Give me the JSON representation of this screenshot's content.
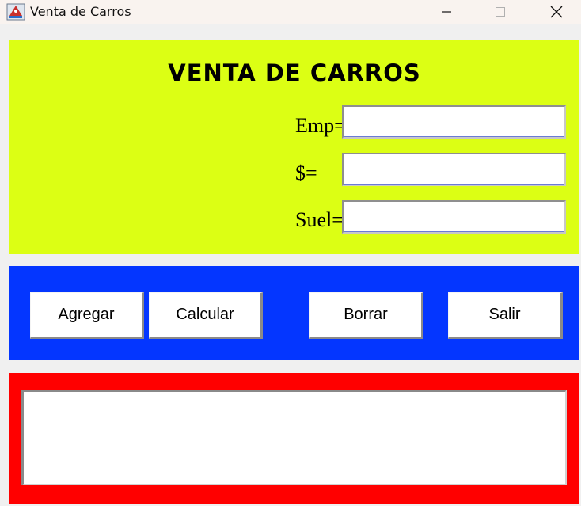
{
  "window": {
    "title": "Venta de Carros",
    "controls": [
      "minimize-icon",
      "maximize-icon",
      "close-icon"
    ]
  },
  "header": {
    "heading": "VENTA DE CARROS"
  },
  "form": {
    "fields": [
      {
        "label": "Emp=",
        "value": ""
      },
      {
        "label": "$=",
        "value": ""
      },
      {
        "label": "Suel=",
        "value": ""
      }
    ]
  },
  "buttons": {
    "agregar": "Agregar",
    "calcular": "Calcular",
    "borrar": "Borrar",
    "salir": "Salir"
  },
  "output": {
    "text": ""
  },
  "colors": {
    "top_panel": "#dcff14",
    "button_panel": "#0436ff",
    "output_panel": "#ff0000"
  }
}
